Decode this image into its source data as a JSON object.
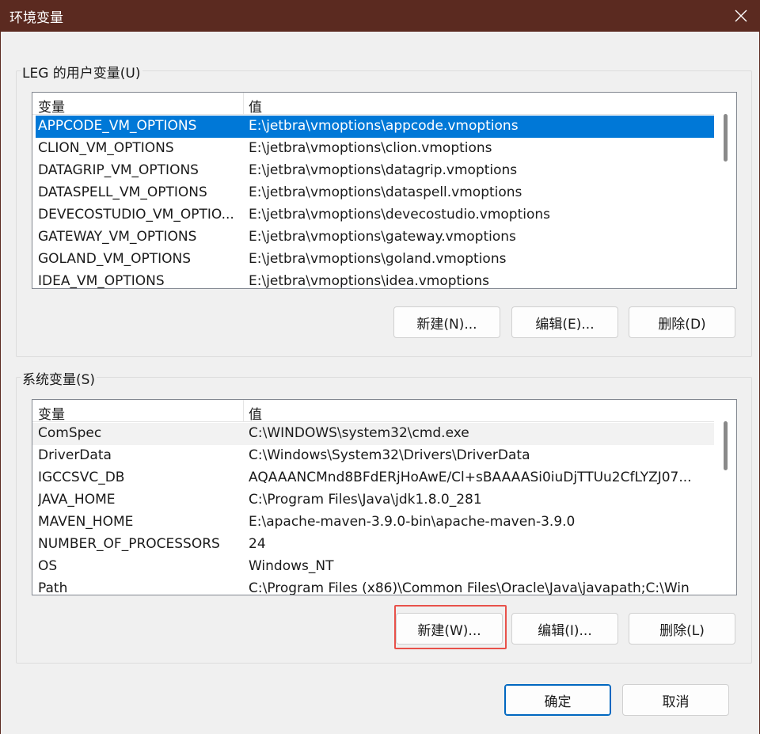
{
  "window": {
    "title": "环境变量"
  },
  "user_vars": {
    "group_label": "LEG 的用户变量(U)",
    "header": {
      "name": "变量",
      "value": "值"
    },
    "rows": [
      {
        "name": "APPCODE_VM_OPTIONS",
        "value": "E:\\jetbra\\vmoptions\\appcode.vmoptions",
        "selected": true
      },
      {
        "name": "CLION_VM_OPTIONS",
        "value": "E:\\jetbra\\vmoptions\\clion.vmoptions"
      },
      {
        "name": "DATAGRIP_VM_OPTIONS",
        "value": "E:\\jetbra\\vmoptions\\datagrip.vmoptions"
      },
      {
        "name": "DATASPELL_VM_OPTIONS",
        "value": "E:\\jetbra\\vmoptions\\dataspell.vmoptions"
      },
      {
        "name": "DEVECOSTUDIO_VM_OPTIO...",
        "value": "E:\\jetbra\\vmoptions\\devecostudio.vmoptions"
      },
      {
        "name": "GATEWAY_VM_OPTIONS",
        "value": "E:\\jetbra\\vmoptions\\gateway.vmoptions"
      },
      {
        "name": "GOLAND_VM_OPTIONS",
        "value": "E:\\jetbra\\vmoptions\\goland.vmoptions"
      },
      {
        "name": "IDEA_VM_OPTIONS",
        "value": "E:\\jetbra\\vmoptions\\idea.vmoptions"
      }
    ],
    "buttons": {
      "new": "新建(N)...",
      "edit": "编辑(E)...",
      "delete": "删除(D)"
    }
  },
  "system_vars": {
    "group_label": "系统变量(S)",
    "header": {
      "name": "变量",
      "value": "值"
    },
    "rows": [
      {
        "name": "ComSpec",
        "value": "C:\\WINDOWS\\system32\\cmd.exe",
        "hover": true
      },
      {
        "name": "DriverData",
        "value": "C:\\Windows\\System32\\Drivers\\DriverData"
      },
      {
        "name": "IGCCSVC_DB",
        "value": "AQAAANCMnd8BFdERjHoAwE/Cl+sBAAAASi0iuDjTTUu2CfLYZJ07..."
      },
      {
        "name": "JAVA_HOME",
        "value": "C:\\Program Files\\Java\\jdk1.8.0_281"
      },
      {
        "name": "MAVEN_HOME",
        "value": "E:\\apache-maven-3.9.0-bin\\apache-maven-3.9.0"
      },
      {
        "name": "NUMBER_OF_PROCESSORS",
        "value": "24"
      },
      {
        "name": "OS",
        "value": "Windows_NT"
      },
      {
        "name": "Path",
        "value": "C:\\Program Files (x86)\\Common Files\\Oracle\\Java\\javapath;C:\\Win"
      }
    ],
    "buttons": {
      "new": "新建(W)...",
      "edit": "编辑(I)...",
      "delete": "删除(L)"
    }
  },
  "footer": {
    "ok": "确定",
    "cancel": "取消"
  },
  "colors": {
    "titlebar": "#5b2a20",
    "selection": "#0078d7",
    "highlight": "#e8514a"
  },
  "icons": {
    "close": "close-icon"
  }
}
